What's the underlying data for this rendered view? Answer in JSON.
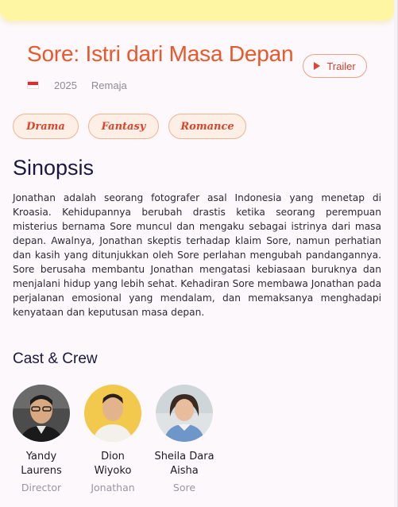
{
  "movie": {
    "title": "Sore: Istri dari Masa Depan",
    "year": "2025",
    "rating": "Remaja",
    "trailer_label": "Trailer"
  },
  "genres": [
    "Drama",
    "Fantasy",
    "Romance"
  ],
  "synopsis": {
    "heading": "Sinopsis",
    "text": "Jonathan adalah seorang fotografer asal Indonesia yang menetap di Kroasia. Kehidupannya berubah drastis ketika seorang perempuan misterius bernama Sore muncul dan mengaku sebagai istrinya dari masa depan. Awalnya, Jonathan skeptis terhadap klaim Sore, namun perhatian dan kasih yang ditunjukkan oleh Sore perlahan mengubah pandangannya. Sore berusaha membantu Jonathan mengatasi kebiasaan buruknya dan menjalani hidup yang lebih sehat. Kehadiran Sore membawa Jonathan pada perjalanan emosional yang mendalam, dan memaksanya menghadapi kenyataan dan keputusan masa depan."
  },
  "cast": {
    "heading": "Cast & Crew",
    "members": [
      {
        "name": "Yandy Laurens",
        "role": "Director"
      },
      {
        "name": "Dion Wiyoko",
        "role": "Jonathan"
      },
      {
        "name": "Sheila Dara Aisha",
        "role": "Sore"
      }
    ]
  },
  "colors": {
    "accent": "#e8582b",
    "banner": "#fef6a3",
    "background": "#fdf8fc",
    "heading": "#1a1840"
  },
  "icons": {
    "trailer": "play-icon",
    "country": "indonesia-flag-icon"
  }
}
